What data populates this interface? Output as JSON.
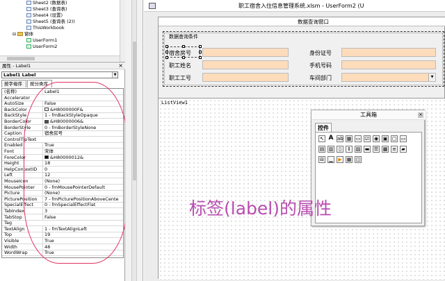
{
  "tree": {
    "items": [
      "Sheet2 (数据表)",
      "Sheet3 (查询表)",
      "Sheet4 (设置)",
      "Sheet5 (查询表 (2))",
      "ThisWorkbook",
      "窗体",
      "UserForm1",
      "UserForm2"
    ]
  },
  "properties_panel": {
    "title": "属性 - Label1",
    "close": "×",
    "object_select": "Label1 Label",
    "tabs": [
      "按字母序",
      "按分类序"
    ],
    "rows": [
      {
        "name": "(名称)",
        "value": "Label1"
      },
      {
        "name": "Accelerator",
        "value": ""
      },
      {
        "name": "AutoSize",
        "value": "False"
      },
      {
        "name": "BackColor",
        "value": "&H8000000F&",
        "swatch": "#f0f0f0"
      },
      {
        "name": "BackStyle",
        "value": "1 - fmBackStyleOpaque"
      },
      {
        "name": "BorderColor",
        "value": "&H80000006&",
        "swatch": "#505050"
      },
      {
        "name": "BorderStyle",
        "value": "0 - fmBorderStyleNone"
      },
      {
        "name": "Caption",
        "value": "宿舍房号"
      },
      {
        "name": "ControlTipText",
        "value": ""
      },
      {
        "name": "Enabled",
        "value": "True"
      },
      {
        "name": "Font",
        "value": "宋体"
      },
      {
        "name": "ForeColor",
        "value": "&H80000012&",
        "swatch": "#000000"
      },
      {
        "name": "Height",
        "value": "18"
      },
      {
        "name": "HelpContextID",
        "value": "0"
      },
      {
        "name": "Left",
        "value": "12"
      },
      {
        "name": "MouseIcon",
        "value": "(None)"
      },
      {
        "name": "MousePointer",
        "value": "0 - fmMousePointerDefault"
      },
      {
        "name": "Picture",
        "value": "(None)"
      },
      {
        "name": "PicturePosition",
        "value": "7 - fmPicturePositionAboveCente"
      },
      {
        "name": "SpecialEffect",
        "value": "0 - fmSpecialEffectFlat"
      },
      {
        "name": "TabIndex",
        "value": "3"
      },
      {
        "name": "TabStop",
        "value": "False"
      },
      {
        "name": "Tag",
        "value": ""
      },
      {
        "name": "TextAlign",
        "value": "1 - fmTextAlignLeft"
      },
      {
        "name": "Top",
        "value": "19"
      },
      {
        "name": "Visible",
        "value": "True"
      },
      {
        "name": "Width",
        "value": "48"
      },
      {
        "name": "WordWrap",
        "value": "True"
      }
    ]
  },
  "window": {
    "title": "职工宿舍入住信息管理系统.xlsm - UserForm2 (U"
  },
  "userform": {
    "caption": "数据查询窗口",
    "frame_caption": "数据查询条件",
    "labels": {
      "room": "宿舍房号",
      "id_card": "身份证号",
      "name": "职工姓名",
      "phone": "手机号码",
      "emp_no": "职工工号",
      "dept": "车间部门"
    },
    "listview_label": "ListView1"
  },
  "toolbox": {
    "title": "工具箱",
    "close": "×",
    "tab": "控件",
    "tools": [
      "arrow",
      "A",
      "ab",
      "grid",
      "frame",
      "checkbox",
      "option",
      "toggle",
      "framebox",
      "button",
      "tabstrip",
      "multipage",
      "scroll",
      "spin",
      "image",
      "refedit",
      "listview",
      "imagelist",
      "treeview",
      "progress",
      "slider",
      "statusbar",
      "media",
      "calendar",
      "other"
    ]
  },
  "annotation": "标签(label)的属性",
  "colors": {
    "textbox_fill": "#fddcbc",
    "annotation": "#b84db0",
    "oval": "#e03060"
  }
}
